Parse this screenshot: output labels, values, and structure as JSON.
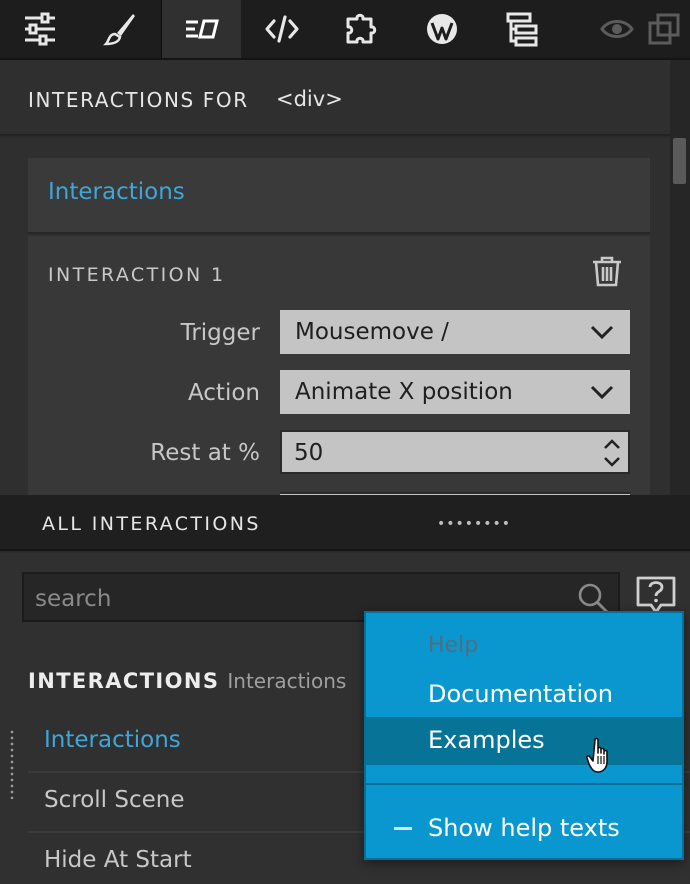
{
  "toolbar": {
    "tabs": [
      {
        "icon": "sliders-icon"
      },
      {
        "icon": "brush-icon"
      },
      {
        "icon": "interactions-icon",
        "active": true
      },
      {
        "icon": "code-icon"
      },
      {
        "icon": "puzzle-icon"
      },
      {
        "icon": "wordpress-icon"
      },
      {
        "icon": "tree-icon"
      }
    ],
    "right_icons": [
      "eye-icon",
      "duplicate-icon"
    ]
  },
  "header": {
    "title": "INTERACTIONS FOR",
    "element": "<div>"
  },
  "card": {
    "heading": "Interactions",
    "interaction_title": "INTERACTION 1",
    "fields": {
      "trigger_label": "Trigger",
      "trigger_value": "Mousemove /",
      "action_label": "Action",
      "action_value": "Animate X position",
      "rest_label": "Rest at %",
      "rest_value": "50"
    }
  },
  "all_interactions": {
    "label": "ALL INTERACTIONS",
    "grip": "••••••••"
  },
  "search": {
    "placeholder": "search"
  },
  "section": {
    "title": "INTERACTIONS",
    "subtitle": "Interactions"
  },
  "list": [
    "Interactions",
    "Scroll Scene",
    "Hide At Start"
  ],
  "menu": {
    "header": "Help",
    "documentation": "Documentation",
    "examples": "Examples",
    "show_help": "Show help texts"
  },
  "colors": {
    "accent": "#3ea6d9",
    "menu_bg": "#0a97cf",
    "menu_hover": "#067397"
  }
}
